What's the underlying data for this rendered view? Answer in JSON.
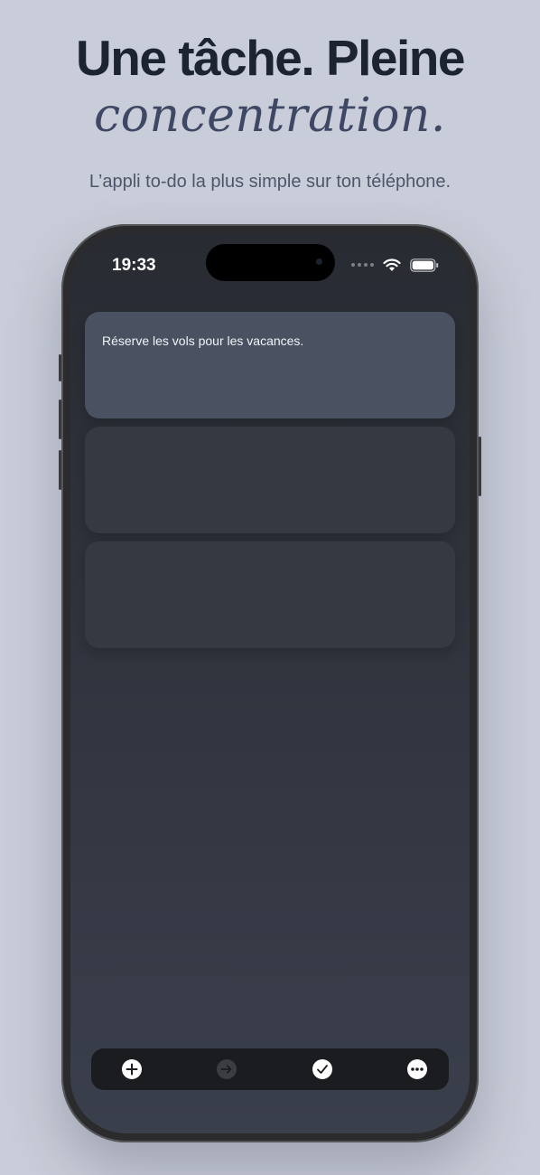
{
  "headline": {
    "line1": "Une tâche. Pleine",
    "line2": "concentration."
  },
  "subtitle": "L’appli to-do la plus simple sur ton téléphone.",
  "status_bar": {
    "time": "19:33",
    "icons": [
      "cellular-dots-icon",
      "wifi-icon",
      "battery-icon"
    ]
  },
  "tasks": [
    {
      "text": "Réserve les vols pour les vacances.",
      "active": true
    },
    {
      "text": "",
      "active": false
    },
    {
      "text": "",
      "active": false
    }
  ],
  "toolbar": {
    "buttons": [
      {
        "icon": "plus-icon",
        "enabled": true
      },
      {
        "icon": "arrow-right-icon",
        "enabled": false
      },
      {
        "icon": "checkmark-icon",
        "enabled": true
      },
      {
        "icon": "more-icon",
        "enabled": true
      }
    ]
  },
  "colors": {
    "background": "#c9cdd9",
    "headline": "#1c2331",
    "accent_italic": "#3e4763",
    "active_card": "#4a5160",
    "inactive_card": "#363941",
    "toolbar": "#1b1c1f"
  }
}
